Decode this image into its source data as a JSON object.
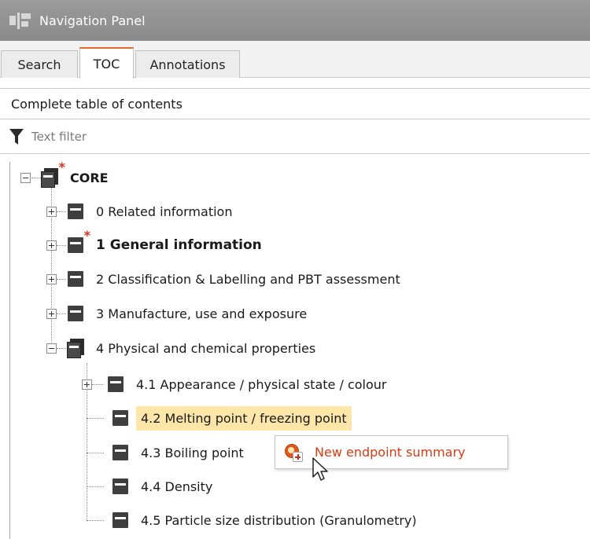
{
  "panel": {
    "title": "Navigation Panel"
  },
  "tabs": [
    {
      "label": "Search",
      "active": false
    },
    {
      "label": "TOC",
      "active": true
    },
    {
      "label": "Annotations",
      "active": false
    }
  ],
  "toc_header": "Complete table of contents",
  "filter": {
    "placeholder": "Text filter",
    "value": ""
  },
  "tree": {
    "root": {
      "label": "CORE",
      "expanded": true,
      "modified": true
    },
    "items": [
      {
        "label": "0 Related information",
        "expanded": false
      },
      {
        "label": "1 General information",
        "expanded": false,
        "modified": true
      },
      {
        "label": "2 Classification & Labelling and PBT assessment",
        "expanded": false
      },
      {
        "label": "3 Manufacture, use and exposure",
        "expanded": false
      },
      {
        "label": "4 Physical and chemical properties",
        "expanded": true
      }
    ],
    "children": [
      {
        "label": "4.1 Appearance / physical state / colour",
        "expandable": true
      },
      {
        "label": "4.2 Melting point / freezing point",
        "selected": true
      },
      {
        "label": "4.3 Boiling point"
      },
      {
        "label": "4.4 Density"
      },
      {
        "label": "4.5 Particle size distribution (Granulometry)"
      }
    ]
  },
  "context_menu": {
    "item_label": "New endpoint summary"
  },
  "colors": {
    "accent": "#e26a2c",
    "selection": "#fde6a8",
    "modified_star": "#d9311b",
    "menu_text": "#d93b13",
    "titlebar": "#939393"
  }
}
